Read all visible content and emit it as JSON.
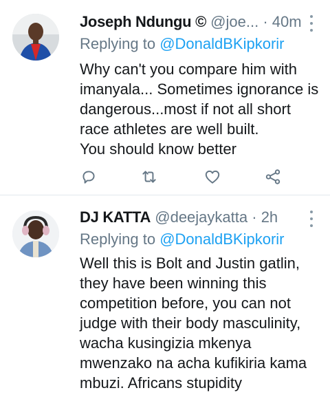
{
  "tweets": [
    {
      "name": "Joseph Ndungu ©",
      "handle": "@joe...",
      "dot": "·",
      "time": "40m",
      "replying_prefix": "Replying to",
      "replying_to": "@DonaldBKipkorir",
      "lines": [
        "Why can't you compare him with",
        "imanyala... Sometimes ignorance is",
        "dangerous...most if not all short",
        "race athletes are well built.",
        "You should know better"
      ],
      "icons": [
        "reply-icon",
        "retweet-icon",
        "like-icon",
        "share-icon"
      ]
    },
    {
      "name": "DJ KATTA",
      "handle": "@deejaykatta",
      "dot": "·",
      "time": "2h",
      "replying_prefix": "Replying to",
      "replying_to": "@DonaldBKipkorir",
      "lines": [
        "Well this is Bolt and Justin gatlin,",
        "they have been winning this",
        "competition before, you can not",
        "judge with their body masculinity,",
        "wacha kusingizia mkenya",
        "mwenzako na acha kufikiria kama",
        "mbuzi. Africans stupidity"
      ]
    }
  ],
  "colors": {
    "accent": "#1da1f2",
    "secondary_text": "#657786",
    "divider": "#e1e8ed"
  }
}
